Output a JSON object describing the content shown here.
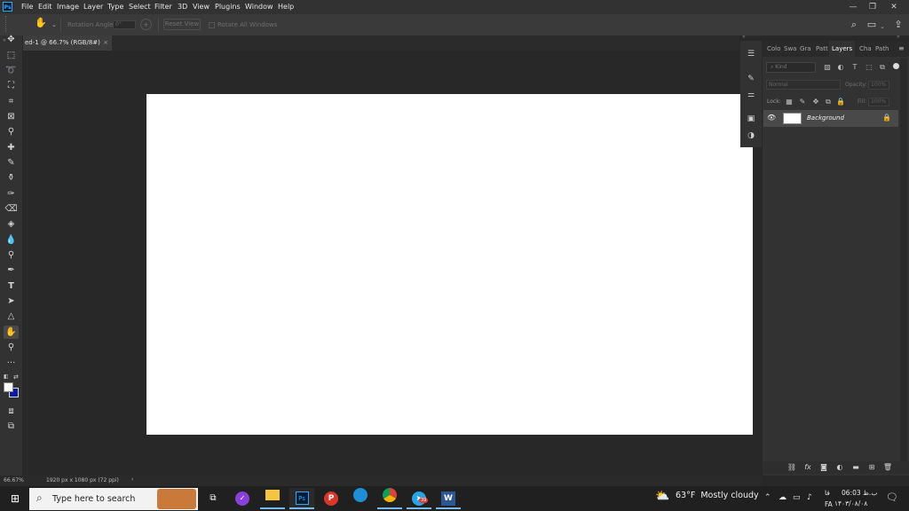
{
  "app": {
    "logo": "Ps",
    "menu": [
      "File",
      "Edit",
      "Image",
      "Layer",
      "Type",
      "Select",
      "Filter",
      "3D",
      "View",
      "Plugins",
      "Window",
      "Help"
    ]
  },
  "window_controls": {
    "minimize": "—",
    "restore": "❐",
    "close": "✕"
  },
  "options_bar": {
    "rotation_label": "Rotation Angle:",
    "rotation_value": "0°",
    "reset_view": "Reset View",
    "rotate_all": "Rotate All Windows"
  },
  "document": {
    "tab_title": "ed-1 @ 66.7% (RGB/8#)",
    "close": "×"
  },
  "status_bar": {
    "zoom": "66.67%",
    "dimensions": "1920 px x 1080 px (72 ppi)",
    "arrow": "›"
  },
  "panel": {
    "tabs": [
      "Colo",
      "Swa",
      "Gra",
      "Patt",
      "Layers",
      "Cha",
      "Path"
    ],
    "active_tab": "Layers",
    "kind_label": "Kind",
    "blend_mode": "Normal",
    "opacity_label": "Opacity:",
    "opacity_value": "100%",
    "lock_label": "Lock:",
    "fill_label": "Fill:",
    "fill_value": "100%",
    "layers": [
      {
        "name": "Background",
        "visible": true,
        "locked": true
      }
    ]
  },
  "taskbar": {
    "search_placeholder": "Type here to search",
    "weather_temp": "63°F",
    "weather_text": "Mostly cloudy",
    "language": "FA",
    "lang_script": "فا",
    "time": "06:03 ب.ظ",
    "date": "۱۴۰۳/۰۸/۰۸",
    "badge": "39"
  },
  "colors": {
    "accent": "#31a8ff",
    "foreground_swatch": "#ffffff",
    "background_swatch": "#0a1aa8",
    "taskbar_indicator": "#76b9ed"
  }
}
